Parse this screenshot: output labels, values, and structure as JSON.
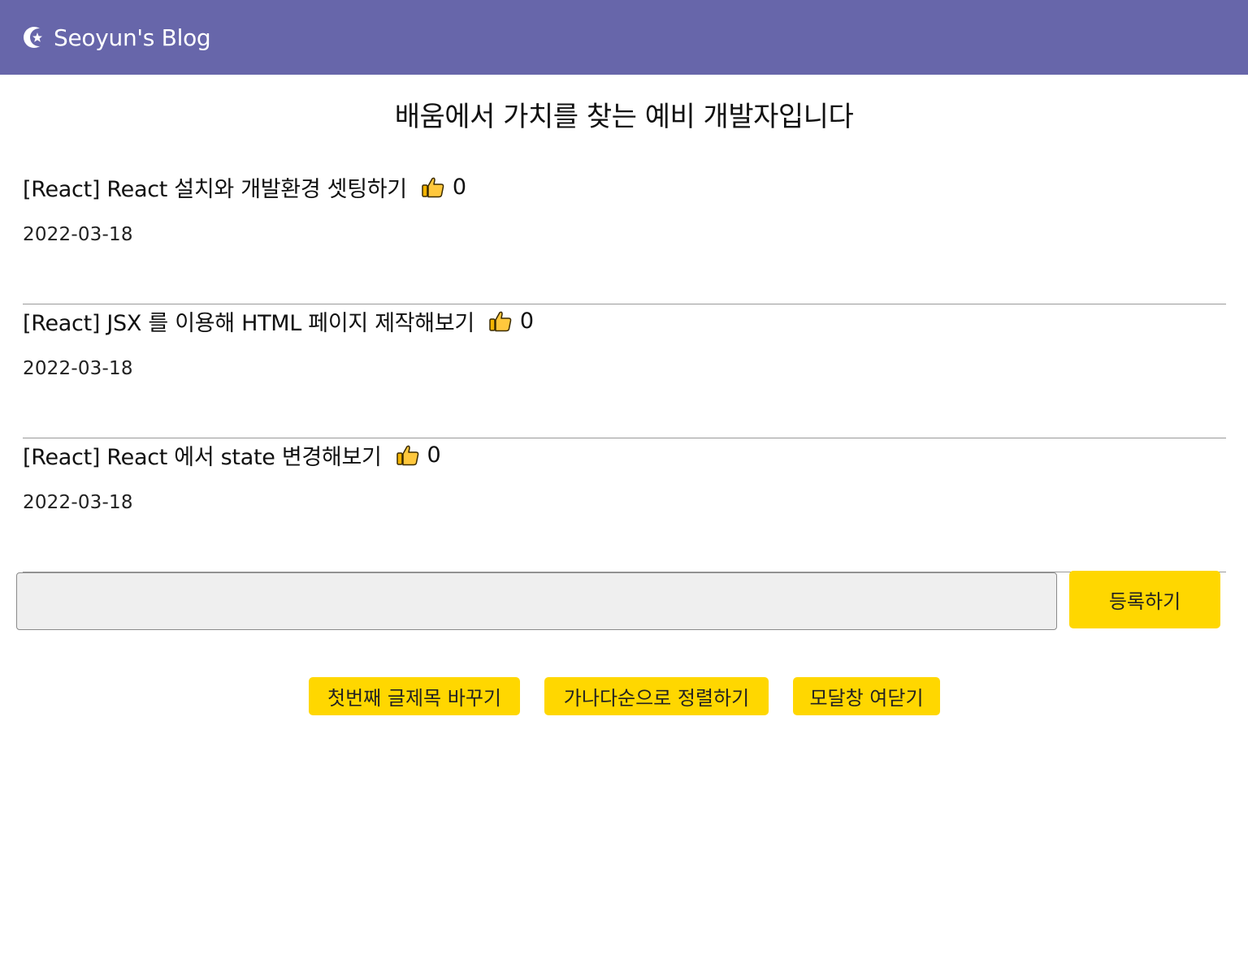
{
  "navbar": {
    "brand_title": "Seoyun's Blog",
    "brand_icon": "moon-star-icon",
    "background_color": "#6766aa"
  },
  "headline": "배움에서 가치를 찾는 예비 개발자입니다",
  "posts": [
    {
      "title": "[React] React 설치와 개발환경 셋팅하기",
      "likes": "0",
      "date": "2022-03-18"
    },
    {
      "title": "[React] JSX 를 이용해 HTML 페이지 제작해보기",
      "likes": "0",
      "date": "2022-03-18"
    },
    {
      "title": "[React] React 에서 state 변경해보기",
      "likes": "0",
      "date": "2022-03-18"
    }
  ],
  "like_icon": "thumbs-up-icon",
  "form": {
    "input_value": "",
    "submit_label": "등록하기"
  },
  "actions": [
    {
      "label": "첫번째 글제목 바꾸기"
    },
    {
      "label": "가나다순으로 정렬하기"
    },
    {
      "label": "모달창 여닫기"
    }
  ],
  "accent_color": "#ffd700"
}
